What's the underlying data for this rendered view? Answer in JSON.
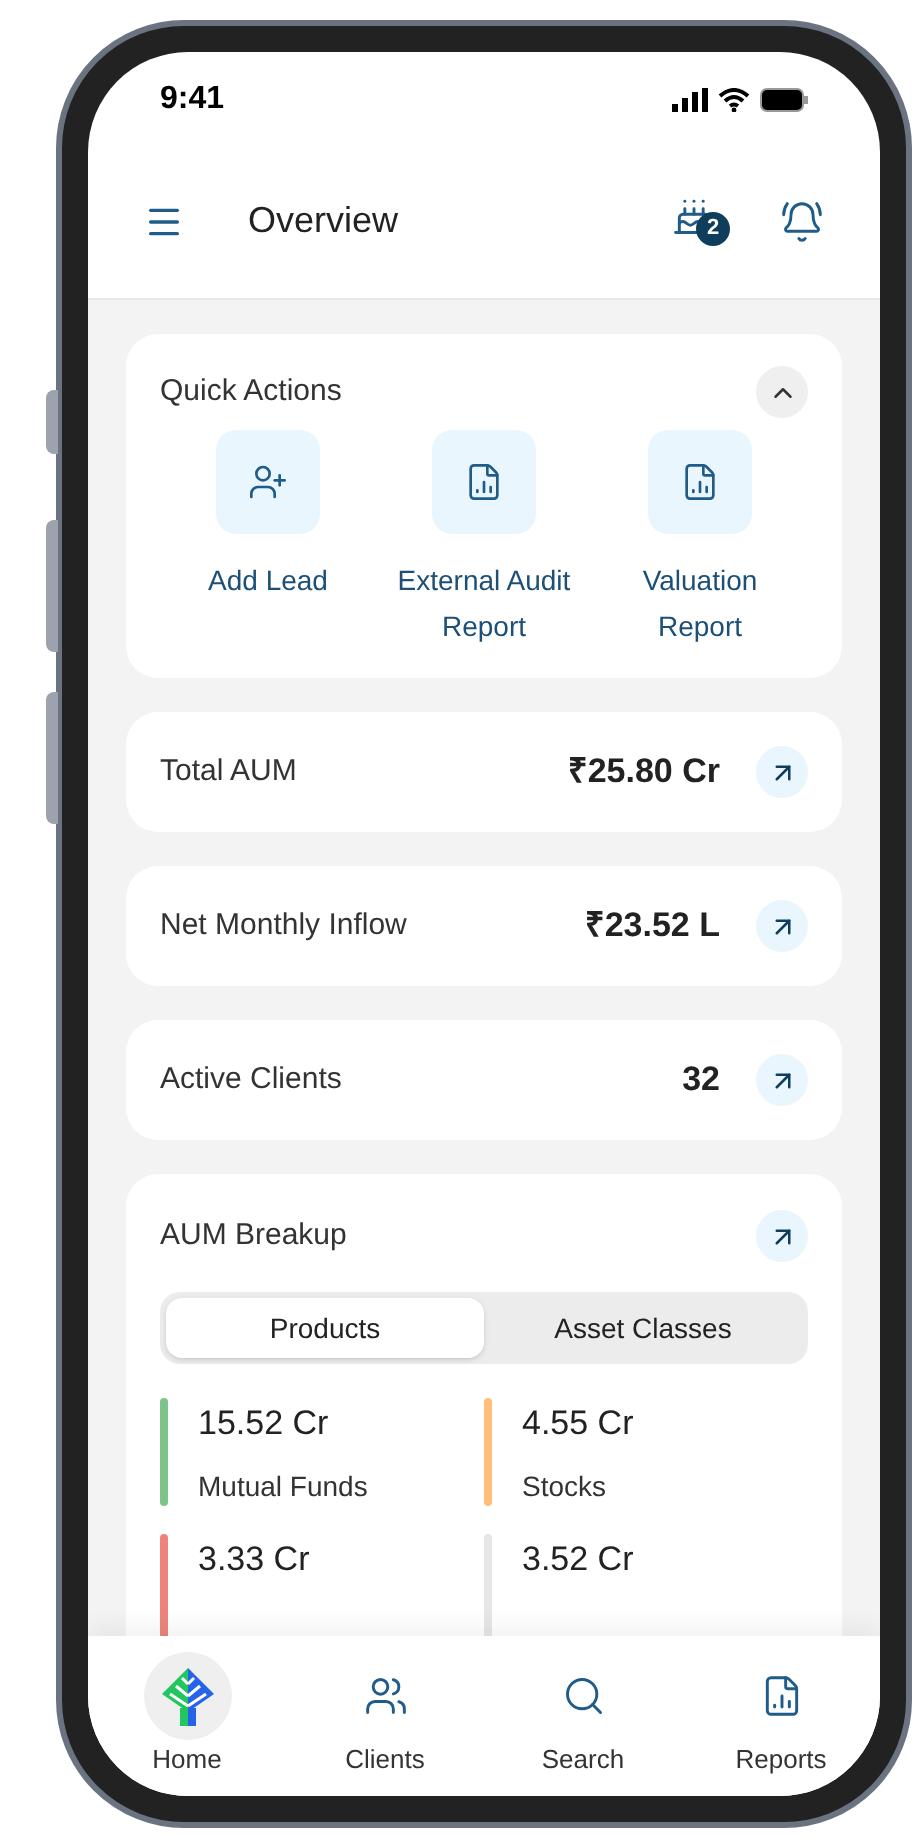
{
  "status_bar": {
    "time": "9:41"
  },
  "header": {
    "title": "Overview",
    "birthday_badge": "2"
  },
  "quick_actions": {
    "title": "Quick Actions",
    "expanded": true,
    "items": [
      {
        "kind": "add-person",
        "label": "Add Lead"
      },
      {
        "kind": "report",
        "label": "External Audit Report"
      },
      {
        "kind": "report",
        "label": "Valuation Report"
      }
    ]
  },
  "metrics": [
    {
      "label": "Total AUM",
      "value": "₹25.80 Cr"
    },
    {
      "label": "Net Monthly Inflow",
      "value": "₹23.52 L"
    },
    {
      "label": "Active Clients",
      "value": "32"
    }
  ],
  "aum_breakup": {
    "title": "AUM Breakup",
    "tabs": [
      {
        "label": "Products",
        "selected": true
      },
      {
        "label": "Asset Classes",
        "selected": false
      }
    ],
    "items": [
      {
        "value": "15.52 Cr",
        "label": "Mutual Funds",
        "color": "#7cc48a"
      },
      {
        "value": "4.55 Cr",
        "label": "Stocks",
        "color": "#ffbe7a"
      },
      {
        "value": "3.33 Cr",
        "color": "#ee8479"
      },
      {
        "value": "3.52 Cr",
        "color": "#e6e6e6"
      }
    ]
  },
  "bottom_nav": [
    {
      "kind": "home",
      "label": "Home",
      "selected": true
    },
    {
      "kind": "clients",
      "label": "Clients",
      "selected": false
    },
    {
      "kind": "search",
      "label": "Search",
      "selected": false
    },
    {
      "kind": "reports",
      "label": "Reports",
      "selected": false
    }
  ]
}
